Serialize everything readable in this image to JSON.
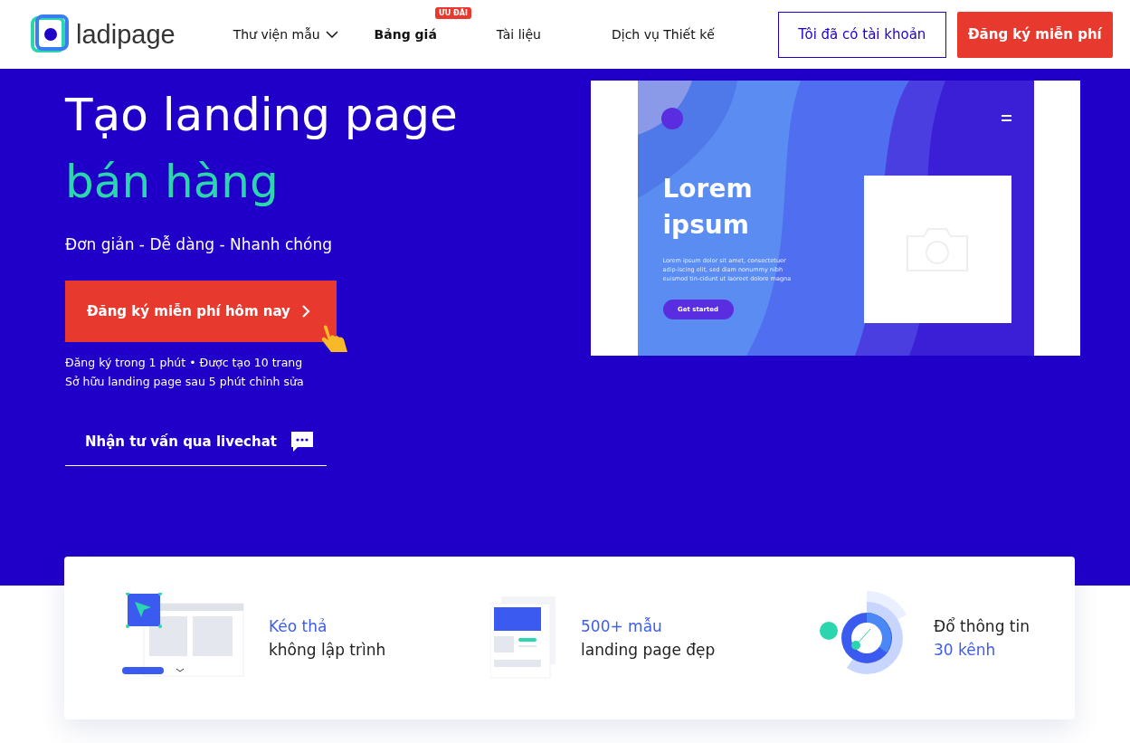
{
  "header": {
    "logo": "ladipage",
    "nav": [
      {
        "label": "Thư viện mẫu",
        "kind": "dropdown",
        "bold": false
      },
      {
        "label": "Bảng giá",
        "kind": "badge",
        "bold": true,
        "badge": "ƯU ĐÃI"
      },
      {
        "label": "Tài liệu",
        "kind": "link",
        "bold": false
      },
      {
        "label": "Dịch vụ Thiết kế",
        "kind": "link",
        "bold": false
      }
    ],
    "login_button": "Tôi đã có tài khoản",
    "signup_button": "Đăng ký miễn phí"
  },
  "hero": {
    "title": "Tạo landing page",
    "title_accent": "bán hàng",
    "subtitle": "Đơn giản - Dễ dàng - Nhanh chóng",
    "cta": "Đăng ký miễn phí hôm nay",
    "notes": [
      "Đăng ký trong 1 phút • Được tạo 10 trang",
      "Sở hữu landing page sau 5 phút chỉnh sửa"
    ],
    "livechat": "Nhận tư vấn qua livechat"
  },
  "preview": {
    "heading": [
      "Lorem",
      "ipsum"
    ],
    "body": "Lorem ipsum dolor sit amet, consectetuer adip-iscing elit, sed diam nonummy nibh euismod tin-cidunt ut laoreet dolore magna",
    "button": "Get started"
  },
  "features": [
    {
      "kind": "dragdrop",
      "lines": [
        {
          "text": "Kéo thả",
          "accent": true
        },
        {
          "text": "không lập trình",
          "accent": false
        }
      ]
    },
    {
      "kind": "templates",
      "lines": [
        {
          "text": "500+ mẫu",
          "accent": true
        },
        {
          "text": "landing page đẹp",
          "accent": false
        }
      ]
    },
    {
      "kind": "channels",
      "lines": [
        {
          "text": "Đổ thông tin",
          "accent": false
        },
        {
          "text": "30 kênh",
          "accent": true
        }
      ]
    }
  ]
}
